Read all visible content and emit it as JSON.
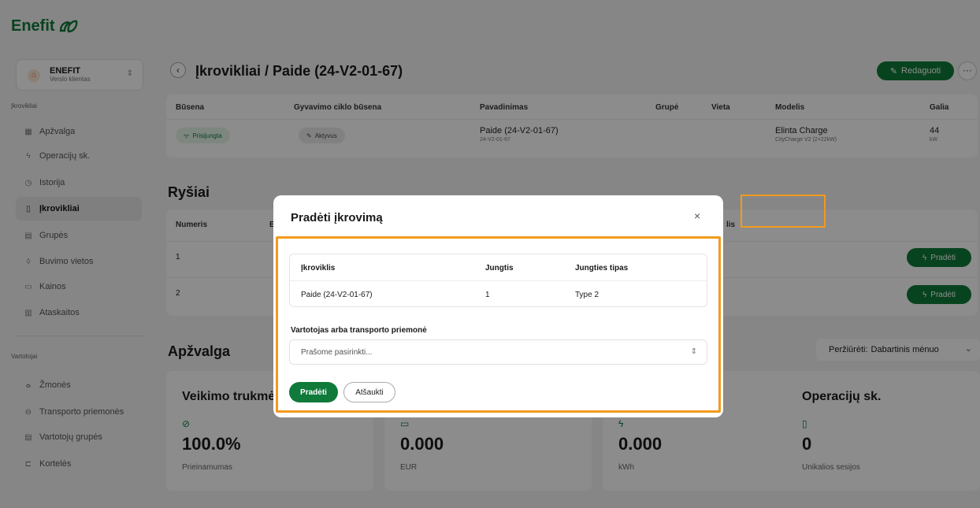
{
  "brand": {
    "name": "Enefit",
    "color": "#0f7a3a",
    "icon": "enefit-leaf-logo"
  },
  "account": {
    "name": "ENEFIT",
    "type": "Verslo klientas"
  },
  "sidebar": {
    "section1": "Įkrovikliai",
    "items": [
      {
        "label": "Apžvalga",
        "icon": "grid-icon"
      },
      {
        "label": "Operacijų sk.",
        "icon": "bolt-icon"
      },
      {
        "label": "Istorija",
        "icon": "clock-icon"
      },
      {
        "label": "Įkrovikliai",
        "icon": "charger-icon",
        "active": true
      },
      {
        "label": "Grupės",
        "icon": "group-icon"
      },
      {
        "label": "Buvimo vietos",
        "icon": "location-icon"
      },
      {
        "label": "Kainos",
        "icon": "price-icon"
      },
      {
        "label": "Ataskaitos",
        "icon": "report-icon"
      }
    ],
    "section2": "Vartotojai",
    "items2": [
      {
        "label": "Žmonės",
        "icon": "people-icon"
      },
      {
        "label": "Transporto priemonės",
        "icon": "car-icon"
      },
      {
        "label": "Vartotojų grupės",
        "icon": "user-group-icon"
      },
      {
        "label": "Kortelės",
        "icon": "card-icon"
      }
    ]
  },
  "header": {
    "title": "Įkrovikliai / Paide (24-V2-01-67)",
    "edit": "Redaguoti",
    "more": "···"
  },
  "info": {
    "headers": [
      "Būsena",
      "Gyvavimo ciklo būsena",
      "Pavadinimas",
      "Grupė",
      "Vieta",
      "Modelis",
      "Galia"
    ],
    "status": "Prisijungta",
    "lifecycle": "Aktyvus",
    "name": "Paide (24-V2-01-67)",
    "name_sub": "24-V2-01-67",
    "model": "Elinta Charge",
    "model_sub": "CityCharge V2 (2×22kW)",
    "power": "44",
    "power_unit": "kW"
  },
  "connections": {
    "title": "Ryšiai",
    "col_number": "Numeris",
    "col_partial": "E",
    "col_partial2": "lis",
    "rows": [
      {
        "num": "1"
      },
      {
        "num": "2"
      }
    ],
    "start": "Pradėti"
  },
  "overview": {
    "title": "Apžvalga",
    "period_label": "Peržiūrėti:",
    "period_value": "Dabartinis mėnuo",
    "cards": [
      {
        "title": "Veikimo trukmė",
        "icon": "check-circle-icon",
        "value": "100.0%",
        "label": "Prieinamumas"
      },
      {
        "title": "",
        "icon": "wallet-icon",
        "value": "0.000",
        "label": "EUR"
      },
      {
        "title": "",
        "icon": "bolt-icon",
        "value": "0.000",
        "label": "kWh"
      },
      {
        "title": "Operacijų sk.",
        "icon": "battery-icon",
        "value": "0",
        "label": "Unikalios sesijos"
      }
    ]
  },
  "modal": {
    "title": "Pradėti įkrovimą",
    "close": "×",
    "table_headers": [
      "Įkroviklis",
      "Jungtis",
      "Jungties tipas"
    ],
    "row": [
      "Paide (24-V2-01-67)",
      "1",
      "Type 2"
    ],
    "select_label": "Vartotojas arba transporto priemonė",
    "select_placeholder": "Prašome pasirinkti...",
    "start": "Pradėti",
    "cancel": "Atšaukti"
  },
  "colors": {
    "accent": "#0f7a3a",
    "highlight": "#f29a1c"
  }
}
